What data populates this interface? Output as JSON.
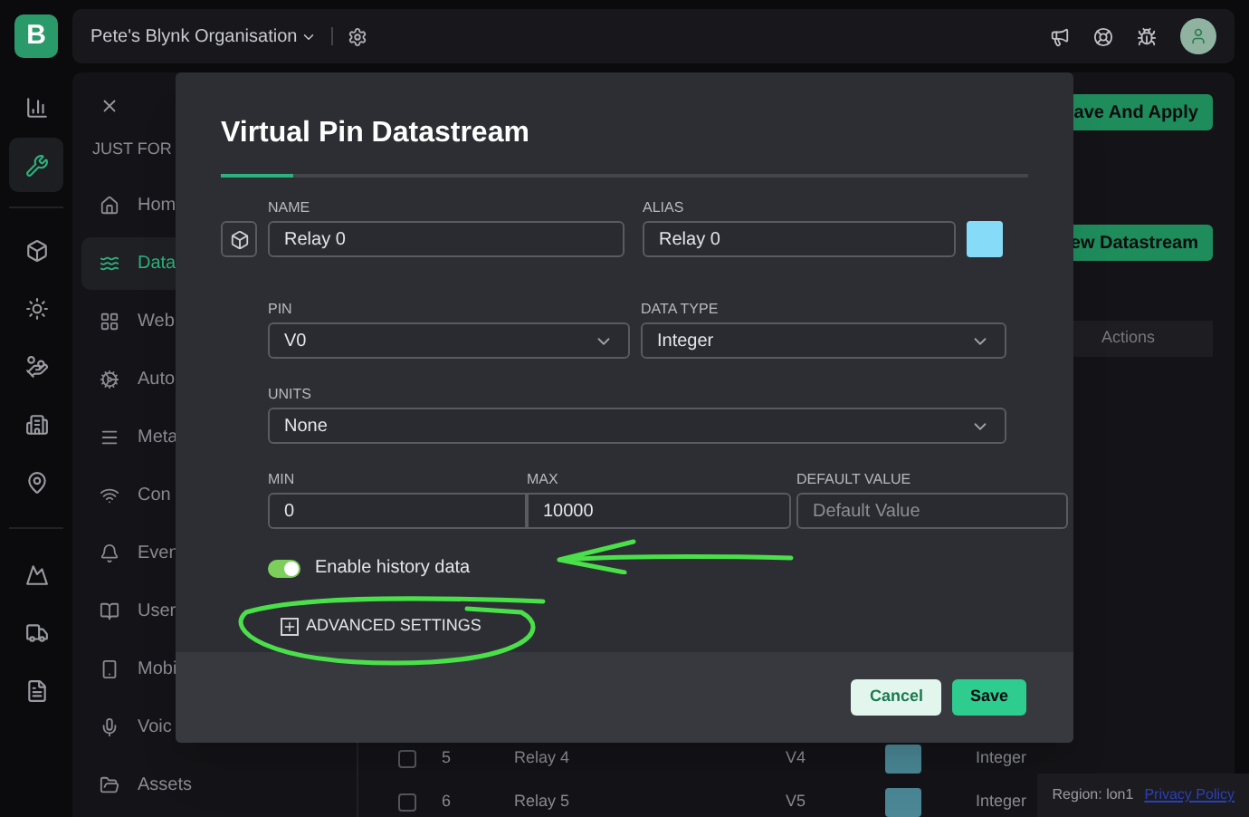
{
  "rail": {
    "logo": "B",
    "items": [
      {
        "selected": false
      },
      {
        "selected": true
      },
      {
        "selected": false
      },
      {
        "selected": false
      },
      {
        "selected": false
      },
      {
        "selected": false
      },
      {
        "selected": false
      },
      {
        "selected": false
      },
      {
        "selected": false
      },
      {
        "selected": false
      }
    ]
  },
  "top_bar": {
    "organisation": "Pete's Blynk Organisation"
  },
  "sidebar": {
    "section": "JUST FOR",
    "items": [
      {
        "label": "Hom",
        "selected": false
      },
      {
        "label": "Data",
        "selected": true
      },
      {
        "label": "Web",
        "selected": false
      },
      {
        "label": "Auto",
        "selected": false
      },
      {
        "label": "Meta",
        "selected": false
      },
      {
        "label": "Con",
        "selected": false
      },
      {
        "label": "Even",
        "selected": false
      },
      {
        "label": "User",
        "selected": false
      },
      {
        "label": "Mobi",
        "selected": false
      },
      {
        "label": "Voic",
        "selected": false
      },
      {
        "label": "Assets",
        "selected": false
      }
    ]
  },
  "content": {
    "save_apply": "ave And Apply",
    "new_datastream": "ew Datastream",
    "table": {
      "columns": [
        "Actions"
      ],
      "rows": [
        {
          "number": "5",
          "name": "Relay 4",
          "pin": "V4",
          "color": "#4b8795",
          "type": "Integer",
          "checked": false
        },
        {
          "number": "6",
          "name": "Relay 5",
          "pin": "V5",
          "color": "#4b8795",
          "type": "Integer",
          "checked": false
        }
      ]
    }
  },
  "dialog": {
    "title": "Virtual Pin Datastream",
    "name": {
      "label": "NAME",
      "value": "Relay 0"
    },
    "alias": {
      "label": "ALIAS",
      "value": "Relay 0"
    },
    "color": "#86dcf8",
    "pin": {
      "label": "PIN",
      "value": "V0"
    },
    "data_type": {
      "label": "DATA TYPE",
      "value": "Integer"
    },
    "units": {
      "label": "UNITS",
      "value": "None"
    },
    "min": {
      "label": "MIN",
      "value": "0"
    },
    "max": {
      "label": "MAX",
      "value": "10000"
    },
    "default_value": {
      "label": "DEFAULT VALUE",
      "placeholder": "Default Value"
    },
    "history": {
      "label": "Enable history data",
      "on": true
    },
    "advanced": "ADVANCED SETTINGS",
    "buttons": {
      "cancel": "Cancel",
      "save": "Save"
    }
  },
  "footer": {
    "region": "Region: lon1",
    "privacy": "Privacy Policy"
  }
}
